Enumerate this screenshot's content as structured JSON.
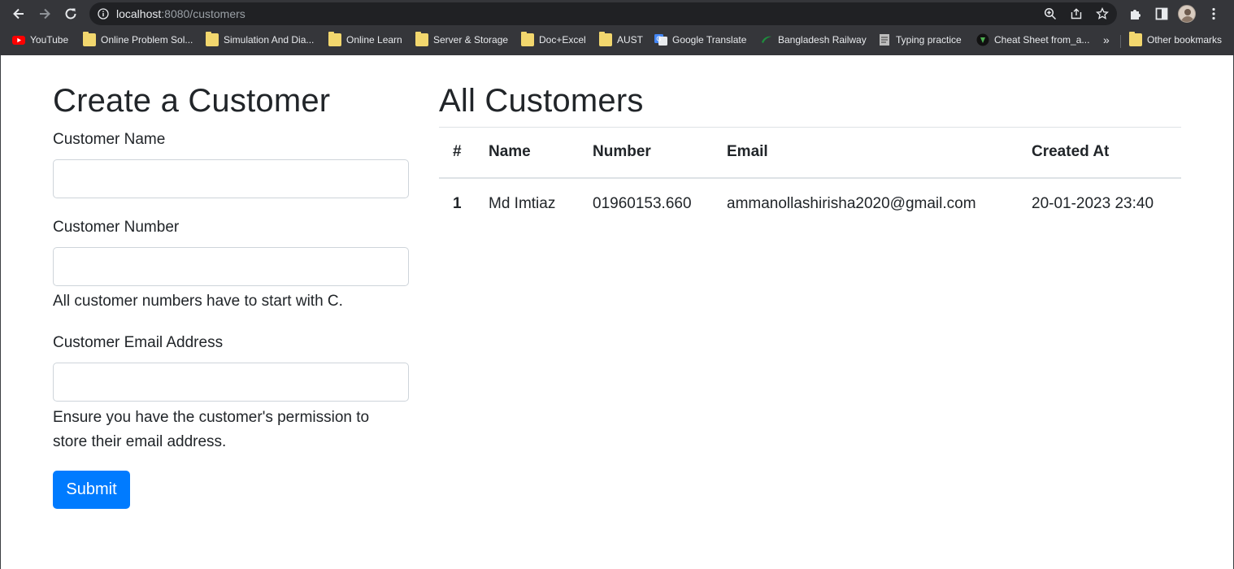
{
  "browser": {
    "url_host": "localhost",
    "url_path": ":8080/customers",
    "bookmarks": [
      {
        "label": "YouTube",
        "icon": "youtube-icon"
      },
      {
        "label": "Online Problem Sol...",
        "icon": "folder-icon"
      },
      {
        "label": "Simulation And Dia...",
        "icon": "folder-icon"
      },
      {
        "label": "Online Learn",
        "icon": "folder-icon"
      },
      {
        "label": "Server & Storage",
        "icon": "folder-icon"
      },
      {
        "label": "Doc+Excel",
        "icon": "folder-icon"
      },
      {
        "label": "AUST",
        "icon": "folder-icon"
      },
      {
        "label": "Google Translate",
        "icon": "google-translate-icon"
      },
      {
        "label": "Bangladesh Railway",
        "icon": "railway-icon"
      },
      {
        "label": "Typing practice",
        "icon": "typing-icon"
      },
      {
        "label": "Cheat Sheet from_a...",
        "icon": "cheatsheet-icon"
      }
    ],
    "overflow": "»",
    "other_bookmarks": "Other bookmarks"
  },
  "form": {
    "title": "Create a Customer",
    "name_label": "Customer Name",
    "name_value": "",
    "number_label": "Customer Number",
    "number_value": "",
    "number_help": "All customer numbers have to start with C.",
    "email_label": "Customer Email Address",
    "email_value": "",
    "email_help_line1": "Ensure you have the customer's permission to",
    "email_help_line2": "store their email address.",
    "submit_label": "Submit"
  },
  "customers": {
    "title": "All Customers",
    "headers": [
      "#",
      "Name",
      "Number",
      "Email",
      "Created At"
    ],
    "rows": [
      [
        "1",
        "Md Imtiaz",
        "01960153.660",
        "ammanollashirisha2020@gmail.com",
        "20-01-2023 23:40"
      ]
    ]
  },
  "colors": {
    "chrome_bg": "#35363a",
    "omnibox_bg": "#202124",
    "primary": "#007bff",
    "text": "#212529"
  }
}
